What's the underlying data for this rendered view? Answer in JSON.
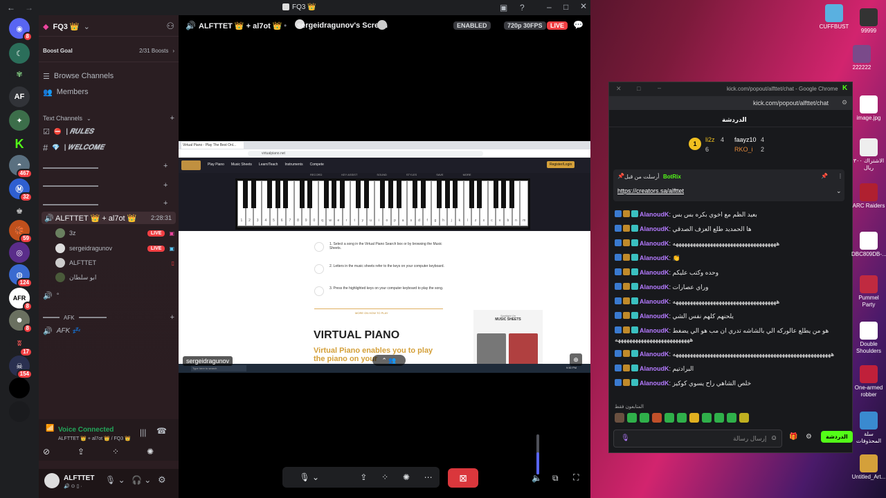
{
  "window": {
    "title": "FQ3 👑"
  },
  "server": {
    "name": "FQ3 👑",
    "boost_goal": "Boost Goal",
    "boost_count": "2/31 Boosts"
  },
  "nav": {
    "browse": "Browse Channels",
    "members": "Members"
  },
  "text_channels": {
    "header": "Text Channels",
    "rules": "| 𝑹𝑼𝑳𝑬𝑺",
    "welcome": "| 𝑾𝑬𝑳𝑪𝑶𝑴𝑬"
  },
  "voice": {
    "channel": "ALFTTET 👑 + al7ot 👑",
    "timer": "2:28:31",
    "users": [
      "3z",
      "sergeidragunov",
      "ALFTTET",
      "ابو سلطان"
    ],
    "live": "LIVE",
    "afk_header": "AFK",
    "afk_channel": "AFK 💤",
    "empty_channel": "°"
  },
  "server_badges": [
    "8",
    "467",
    "32",
    "59",
    "124",
    "8",
    "8",
    "17",
    "154"
  ],
  "server_af": "AF",
  "voice_status": {
    "title": "Voice Connected",
    "sub": "ALFTTET 👑 + al7ot 👑 / FQ3 👑"
  },
  "user": {
    "name": "ALFTTET"
  },
  "stage": {
    "channel": "ALFTTET 👑 + al7ot 👑",
    "screen": "sergeidragunov's Screen",
    "enabled": "ENABLED",
    "quality": "720p 30FPS",
    "live": "LIVE",
    "name_tag": "sergeidragunov"
  },
  "piano": {
    "tab": "Virtual Piano - Play The Best Onl...",
    "url": "virtualpiano.net",
    "nav": [
      "Play Piano",
      "Music Sheets",
      "Learn/Teach",
      "Instruments",
      "Compete"
    ],
    "login": "Register/Login",
    "toolbar": [
      "RECORD",
      "KEY ASSIST",
      "SOUND",
      "STYLES",
      "SAVE",
      "MORE"
    ],
    "white_keys": [
      "1",
      "2",
      "3",
      "4",
      "5",
      "6",
      "7",
      "8",
      "9",
      "0",
      "q",
      "w",
      "e",
      "r",
      "t",
      "y",
      "u",
      "i",
      "o",
      "p",
      "a",
      "s",
      "d",
      "f",
      "g",
      "h",
      "j",
      "k",
      "l",
      "z",
      "x",
      "c",
      "v",
      "b",
      "n",
      "m"
    ],
    "steps": [
      "1. Select a song in the Virtual Piano Search box or by browsing the Music Sheets.",
      "2. Letters in the music sheets refer to the keys on your computer keyboard.",
      "3. Press the highlighted keys on your computer keyboard to play the song."
    ],
    "more": "MORE ON HOW TO PLAY",
    "heading": "VIRTUAL PIANO",
    "tagline": "Virtual Piano enables you to play the piano on your",
    "spotlight_small": "Spotlight On",
    "spotlight": "MUSIC SHEETS",
    "taskbar_search": "Type here to search",
    "taskbar_time": "9:50 PM"
  },
  "chat": {
    "title": "kick.com/popout/alfttet/chat - Google Chrome",
    "url": "kick.com/popout/alfttet/chat",
    "header": "الدردشة",
    "leaders": [
      {
        "rank": "1",
        "name": "li2z",
        "count": "4"
      },
      {
        "name": "faayz10",
        "count": "4"
      },
      {
        "name": "RKO_i",
        "count": "2"
      }
    ],
    "leader_rank2_count": "6",
    "pinned_by": "أرسلت من قبل",
    "pinned_user": "BotRix",
    "pinned_link": "https://creators.sa/alfttet",
    "messages": [
      {
        "user": "AlanoudK",
        "text": "بعيد الظم مع اخوي بكره بس بس"
      },
      {
        "user": "AlanoudK",
        "text": "ها الحمديد طلع العزف الصدقي"
      },
      {
        "user": "AlanoudK",
        "text": "ههههههههههههههههههههههههههههههههههههه"
      },
      {
        "user": "AlanoudK",
        "text": "👏"
      },
      {
        "user": "AlanoudK",
        "text": "وحده وكتب عليكم"
      },
      {
        "user": "AlanoudK",
        "text": "وراي عصارات"
      },
      {
        "user": "AlanoudK",
        "text": "ههههههههههههههههههههههههههههههههههههه"
      },
      {
        "user": "AlanoudK",
        "text": "يلحنهم كلهم نفس الشي"
      },
      {
        "user": "AlanoudK",
        "text": "هو من يطلع عالوركه الي بالشاشه تدري ان مب هو الي يضغط ههههههههههههههههههههههههههه"
      },
      {
        "user": "AlanoudK",
        "text": "هههههههههههههههههههههههههههههههههههههههههههههههههههههههه"
      },
      {
        "user": "AlanoudK",
        "text": "البرادتيم"
      },
      {
        "user": "AlanoudK",
        "text": "خلص الشاهي راح يسوي كوكيز"
      }
    ],
    "emote_label": "المتابعون فقط",
    "input_placeholder": "إرسال رسالة",
    "send": "الدردشة"
  },
  "desktop": {
    "icons": [
      "CUFFBUST",
      "99999",
      "222222",
      "image.jpg",
      "الاشتراك ٣٠٠ ريال",
      "ARC Raiders",
      "DBC809DB-...",
      "Pummel Party",
      "Double Shoulders",
      "One-armed robber",
      "سلة المحذوفات",
      "Untitled_Art..."
    ]
  },
  "colors": {
    "discord_red": "#da373c",
    "kick_green": "#53fc18",
    "live_red": "#f23f43",
    "chat_user": "#b47aff"
  }
}
